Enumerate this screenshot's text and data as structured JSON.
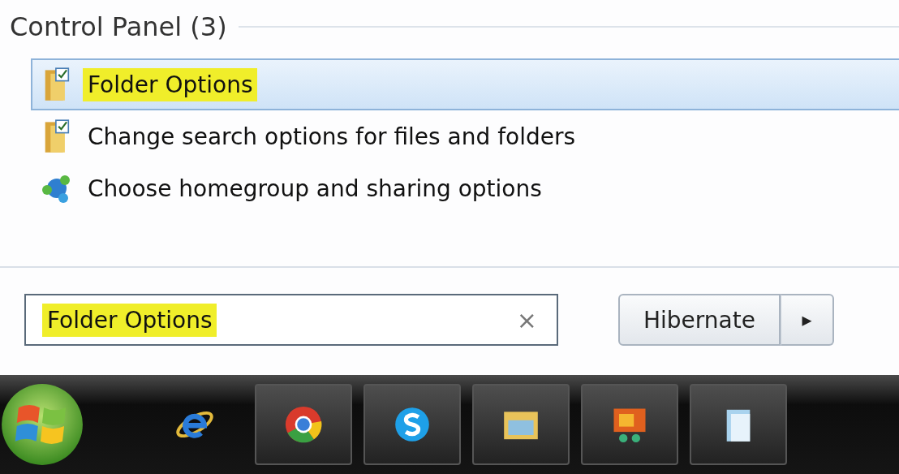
{
  "results_section": {
    "heading": "Control Panel (3)",
    "items": [
      {
        "label": "Folder Options",
        "kind": "folder-options",
        "selected": true,
        "highlighted": true
      },
      {
        "label": "Change search options for files and folders",
        "kind": "folder-options",
        "selected": false,
        "highlighted": false
      },
      {
        "label": "Choose homegroup and sharing options",
        "kind": "homegroup",
        "selected": false,
        "highlighted": false
      }
    ]
  },
  "search": {
    "value": "Folder Options",
    "highlighted": true,
    "clear": "×"
  },
  "power": {
    "label": "Hibernate",
    "arrow": "▸"
  },
  "taskbar": {
    "items": [
      {
        "kind": "browser-e",
        "running": false
      },
      {
        "kind": "browser-ring",
        "running": true
      },
      {
        "kind": "chat",
        "running": true
      },
      {
        "kind": "folder",
        "running": true
      },
      {
        "kind": "media",
        "running": true
      },
      {
        "kind": "notepad",
        "running": true
      }
    ]
  }
}
